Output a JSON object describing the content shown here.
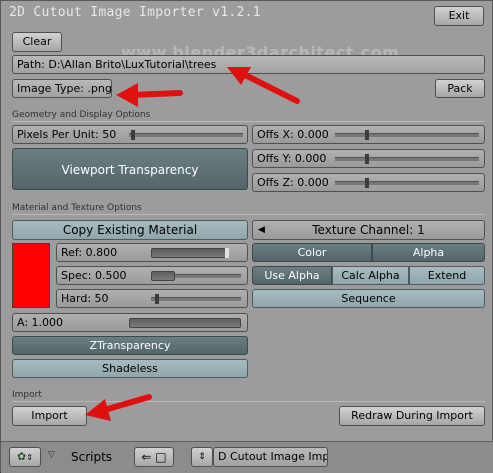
{
  "header": {
    "title": "2D Cutout Image Importer v1.2.1",
    "exit_label": "Exit",
    "watermark": "www.blender3darchitect.com"
  },
  "top": {
    "clear_label": "Clear",
    "path": "Path: D:\\Allan Brito\\LuxTutorial\\trees",
    "image_type": "Image Type: .png",
    "pack_label": "Pack"
  },
  "geometry": {
    "section_label": "Geometry and Display Options",
    "pixels_per_unit": "Pixels Per Unit: 50",
    "viewport_transparency": "Viewport Transparency",
    "offs_x": "Offs X: 0.000",
    "offs_y": "Offs Y: 0.000",
    "offs_z": "Offs Z: 0.000"
  },
  "material": {
    "section_label": "Material and Texture Options",
    "copy_existing": "Copy Existing Material",
    "color_swatch": "#ff0000",
    "ref": "Ref: 0.800",
    "spec": "Spec: 0.500",
    "hard": "Hard: 50",
    "alpha_value": "A: 1.000",
    "alpha_level": 1.0,
    "ref_level": 0.8,
    "texture_channel": "Texture Channel: 1",
    "color_label": "Color",
    "alpha_label": "Alpha",
    "use_alpha": "Use Alpha",
    "calc_alpha": "Calc Alpha",
    "extend": "Extend",
    "sequence": "Sequence",
    "ztransparency": "ZTransparency",
    "shadeless": "Shadeless"
  },
  "import": {
    "section_label": "Import",
    "import_label": "Import",
    "redraw_label": "Redraw During Import"
  },
  "bottombar": {
    "scripts_label": "Scripts",
    "script_name": "D Cutout Image Impo"
  },
  "colors": {
    "arrow": "#e01010",
    "accent_dark": "#5a6d71"
  }
}
